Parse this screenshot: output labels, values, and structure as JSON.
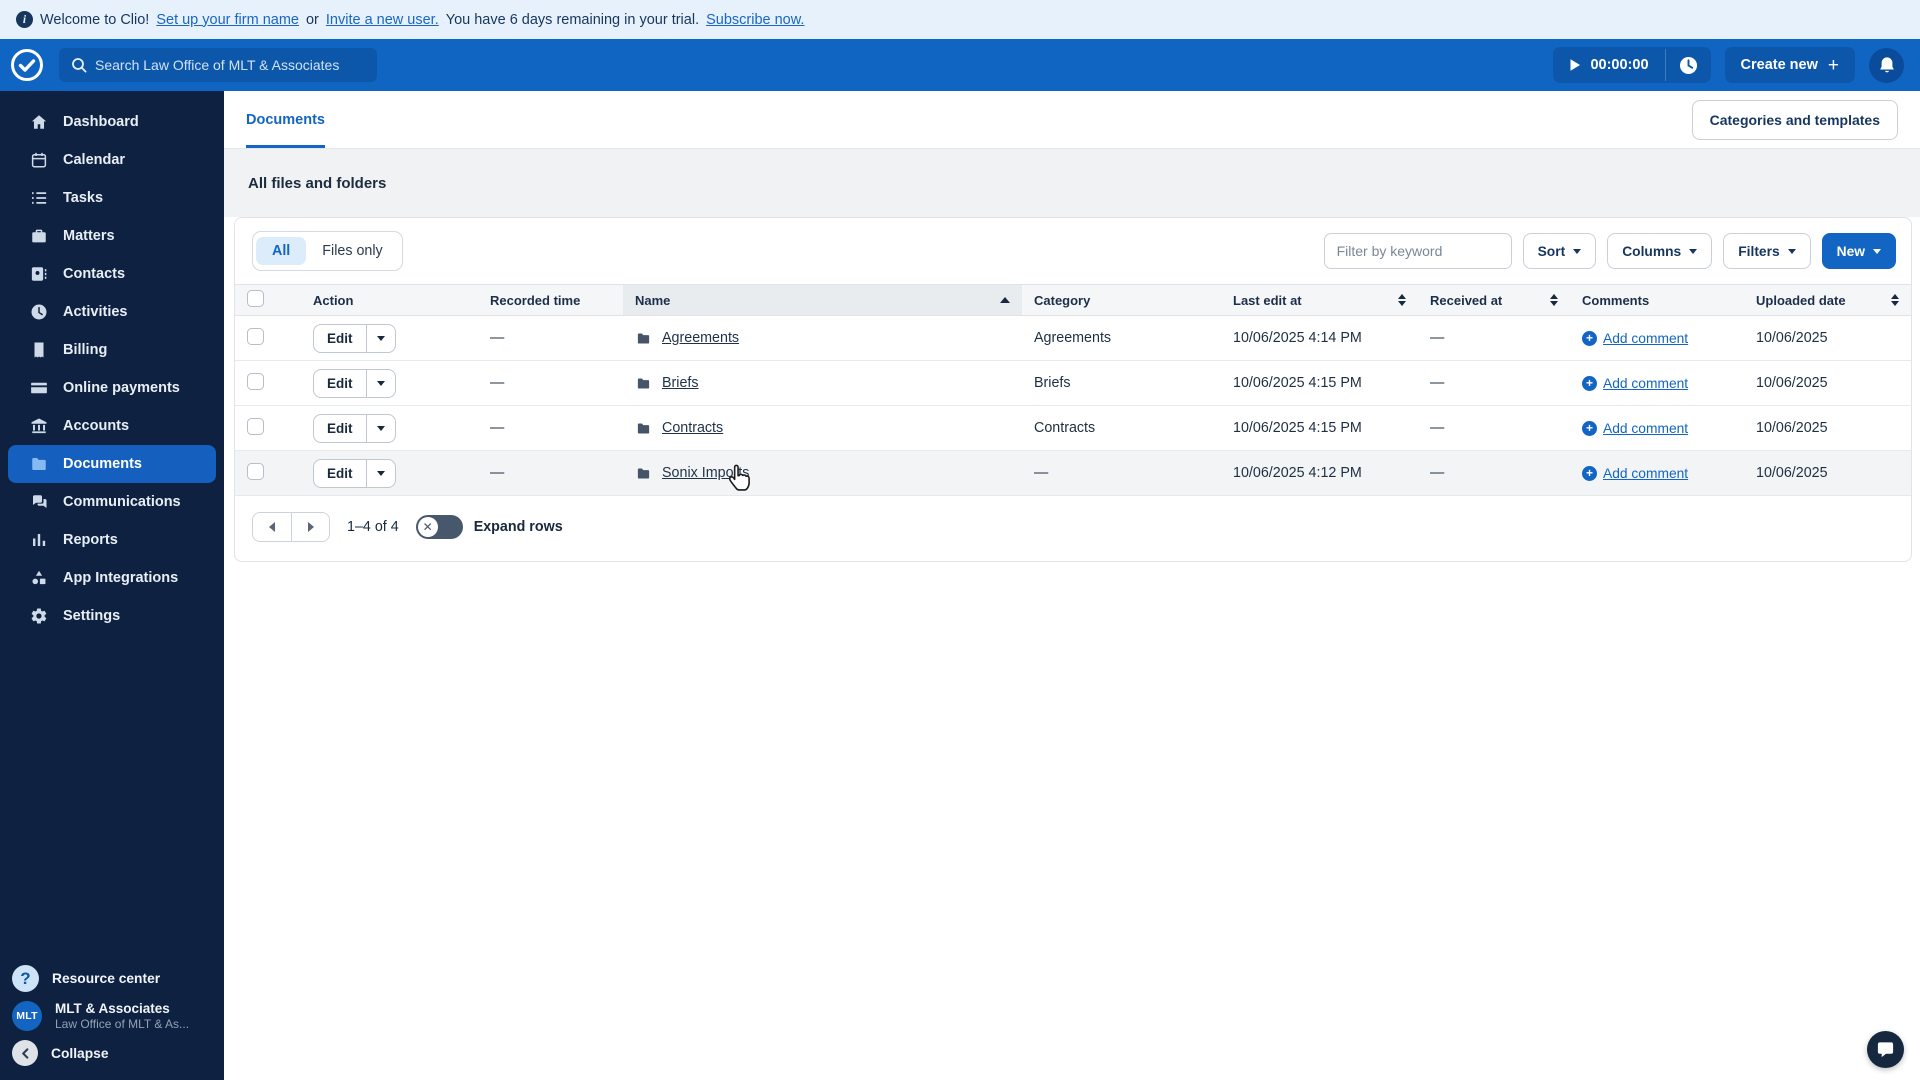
{
  "banner": {
    "icon": "info-icon",
    "welcome": "Welcome to Clio!",
    "link_firm": "Set up your firm name",
    "or": "or",
    "link_invite": "Invite a new user.",
    "trial": "You have 6 days remaining in your trial.",
    "link_subscribe": "Subscribe now."
  },
  "navbar": {
    "logo": "clio-logo",
    "search_placeholder": "Search Law Office of MLT & Associates",
    "timer_value": "00:00:00",
    "create_new_label": "Create new",
    "create_new_plus": "+",
    "colors": {
      "bar": "#1065c2",
      "control": "#0d57ab",
      "accent": "#1265c3"
    }
  },
  "sidebar": {
    "items": [
      {
        "label": "Dashboard",
        "icon": "home-icon",
        "active": false
      },
      {
        "label": "Calendar",
        "icon": "calendar-icon",
        "active": false
      },
      {
        "label": "Tasks",
        "icon": "tasks-icon",
        "active": false
      },
      {
        "label": "Matters",
        "icon": "briefcase-icon",
        "active": false
      },
      {
        "label": "Contacts",
        "icon": "contact-card-icon",
        "active": false
      },
      {
        "label": "Activities",
        "icon": "clock-icon",
        "active": false
      },
      {
        "label": "Billing",
        "icon": "invoice-icon",
        "active": false
      },
      {
        "label": "Online payments",
        "icon": "credit-card-icon",
        "active": false
      },
      {
        "label": "Accounts",
        "icon": "bank-icon",
        "active": false
      },
      {
        "label": "Documents",
        "icon": "folder-icon",
        "active": true
      },
      {
        "label": "Communications",
        "icon": "chat-bubbles-icon",
        "active": false
      },
      {
        "label": "Reports",
        "icon": "bar-chart-icon",
        "active": false
      },
      {
        "label": "App Integrations",
        "icon": "shapes-icon",
        "active": false
      },
      {
        "label": "Settings",
        "icon": "gear-icon",
        "active": false
      }
    ],
    "footer": {
      "resource_center": "Resource center",
      "account_name": "MLT & Associates",
      "account_sub": "Law Office of MLT & As...",
      "avatar_text": "MLT",
      "collapse": "Collapse"
    }
  },
  "page": {
    "tab": "Documents",
    "categories_button": "Categories and templates",
    "heading": "All files and folders"
  },
  "toolbar": {
    "segment_all": "All",
    "segment_files_only": "Files only",
    "filter_placeholder": "Filter by keyword",
    "sort_label": "Sort",
    "columns_label": "Columns",
    "filters_label": "Filters",
    "new_label": "New"
  },
  "table": {
    "columns": [
      {
        "label": "Action",
        "sort": "none"
      },
      {
        "label": "Recorded time",
        "sort": "none"
      },
      {
        "label": "Name",
        "sort": "asc"
      },
      {
        "label": "Category",
        "sort": "none"
      },
      {
        "label": "Last edit at",
        "sort": "both"
      },
      {
        "label": "Received at",
        "sort": "both"
      },
      {
        "label": "Comments",
        "sort": "none"
      },
      {
        "label": "Uploaded date",
        "sort": "both"
      }
    ],
    "edit_label": "Edit",
    "add_comment_label": "Add comment",
    "rows": [
      {
        "action": "Edit",
        "recorded_time": "—",
        "name": "Agreements",
        "category": "Agreements",
        "last_edit": "10/06/2025 4:14 PM",
        "received": "—",
        "comment": "Add comment",
        "uploaded": "10/06/2025",
        "hovered": false
      },
      {
        "action": "Edit",
        "recorded_time": "—",
        "name": "Briefs",
        "category": "Briefs",
        "last_edit": "10/06/2025 4:15 PM",
        "received": "—",
        "comment": "Add comment",
        "uploaded": "10/06/2025",
        "hovered": false
      },
      {
        "action": "Edit",
        "recorded_time": "—",
        "name": "Contracts",
        "category": "Contracts",
        "last_edit": "10/06/2025 4:15 PM",
        "received": "—",
        "comment": "Add comment",
        "uploaded": "10/06/2025",
        "hovered": false
      },
      {
        "action": "Edit",
        "recorded_time": "—",
        "name": "Sonix Imports",
        "category": "—",
        "last_edit": "10/06/2025 4:12 PM",
        "received": "—",
        "comment": "Add comment",
        "uploaded": "10/06/2025",
        "hovered": true
      }
    ]
  },
  "pagination": {
    "range": "1–4 of 4",
    "expand_label": "Expand rows",
    "expand_on": false
  }
}
